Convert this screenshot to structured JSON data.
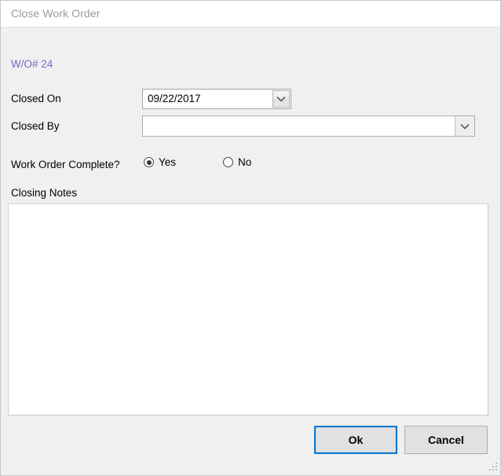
{
  "window": {
    "title": "Close Work Order",
    "accent_blue": "#0b79d0",
    "body_bg": "#f0f0f0",
    "link_color": "#6d6dc8"
  },
  "form": {
    "work_order_label": "W/O# 24",
    "closed_on": {
      "label": "Closed On",
      "value": "09/22/2017",
      "dropdown_icon": "chevron-down-icon"
    },
    "closed_by": {
      "label": "Closed By",
      "value": "",
      "placeholder": "",
      "dropdown_icon": "chevron-down-icon"
    },
    "work_order_complete": {
      "label": "Work Order Complete?",
      "options": [
        {
          "label": "Yes",
          "selected": true
        },
        {
          "label": "No",
          "selected": false
        }
      ]
    },
    "closing_notes": {
      "label": "Closing Notes",
      "value": "",
      "placeholder": ""
    }
  },
  "footer": {
    "ok_label": "Ok",
    "cancel_label": "Cancel",
    "resize_grip": "resize-grip-icon"
  }
}
